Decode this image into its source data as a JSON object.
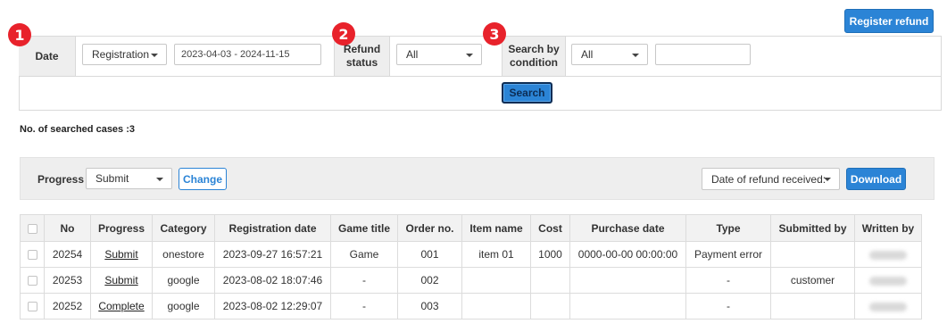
{
  "markers": {
    "one": "1",
    "two": "2",
    "three": "3"
  },
  "header": {
    "register_refund_label": "Register refund"
  },
  "search": {
    "date_label": "Date",
    "date_type_selected": "Registration",
    "date_range_value": "2023-04-03 - 2024-11-15",
    "refund_status_label_line1": "Refund",
    "refund_status_label_line2": "status",
    "refund_status_selected": "All",
    "condition_label_line1": "Search by",
    "condition_label_line2": "condition",
    "condition_selected": "All",
    "condition_value": "",
    "search_button_label": "Search"
  },
  "results": {
    "count_text": "No. of searched cases :3"
  },
  "toolbar": {
    "progress_label": "Progress",
    "progress_selected": "Submit",
    "change_button_label": "Change",
    "sort_selected": "Date of refund received:",
    "download_button_label": "Download"
  },
  "table": {
    "columns": [
      "No",
      "Progress",
      "Category",
      "Registration date",
      "Game title",
      "Order no.",
      "Item name",
      "Cost",
      "Purchase date",
      "Type",
      "Submitted by",
      "Written by"
    ],
    "rows": [
      {
        "no": "20254",
        "progress": "Submit",
        "category": "onestore",
        "registration_date": "2023-09-27 16:57:21",
        "game_title": "Game",
        "order_no": "001",
        "item_name": "item 01",
        "cost": "1000",
        "purchase_date": "0000-00-00 00:00:00",
        "type": "Payment error",
        "submitted_by": ""
      },
      {
        "no": "20253",
        "progress": "Submit",
        "category": "google",
        "registration_date": "2023-08-02 18:07:46",
        "game_title": "-",
        "order_no": "002",
        "item_name": "",
        "cost": "",
        "purchase_date": "",
        "type": "-",
        "submitted_by": "customer"
      },
      {
        "no": "20252",
        "progress": "Complete",
        "category": "google",
        "registration_date": "2023-08-02 12:29:07",
        "game_title": "-",
        "order_no": "003",
        "item_name": "",
        "cost": "",
        "purchase_date": "",
        "type": "-",
        "submitted_by": ""
      }
    ]
  },
  "colors": {
    "accent": "#2b84d6",
    "marker": "#e8222b",
    "panel_bg": "#eeeeee"
  }
}
